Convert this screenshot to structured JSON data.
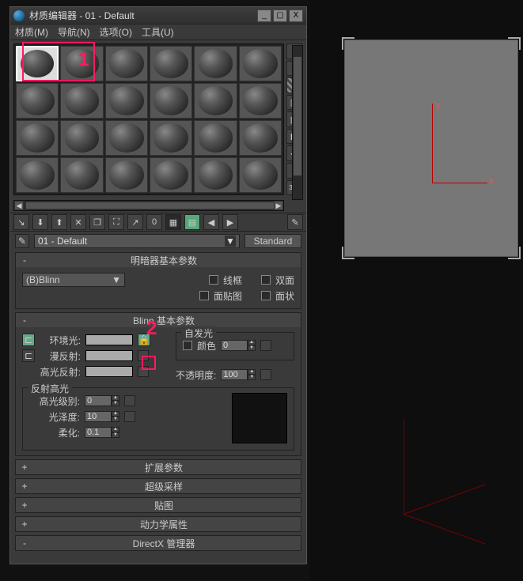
{
  "window": {
    "title": "材质编辑器 - 01 - Default",
    "buttons": {
      "min": "_",
      "max": "▢",
      "close": "X"
    }
  },
  "menubar": {
    "material": "材质(M)",
    "navigate": "导航(N)",
    "options": "选项(O)",
    "tools": "工具(U)"
  },
  "side_tools": {
    "sample_type": "○",
    "backlight": "◐",
    "background": "▦",
    "uv_tiling": "▥",
    "video_check": "▤",
    "preview": "▶",
    "options": "⋯",
    "select_by": "⌕",
    "magnify": "3×2"
  },
  "h_toolbar": {
    "get": "↘",
    "put_scene": "⬇",
    "assign": "⬆",
    "reset": "✕",
    "make_copy": "❐",
    "unique": "⛶",
    "put_lib": "↗",
    "mat_id": "0",
    "show_map": "▦",
    "show_end": "▤",
    "go_parent": "◀",
    "go_sibling": "▶",
    "pick": "✎"
  },
  "name_row": {
    "dropper": "✎",
    "material_name": "01 - Default",
    "type_button": "Standard"
  },
  "shader_params": {
    "title": "明暗器基本参数",
    "shader": "(B)Blinn",
    "wire": "线框",
    "two_sided": "双面",
    "face_map": "面贴图",
    "faceted": "面状"
  },
  "blinn_params": {
    "title": "Blinn 基本参数",
    "ambient": "环境光:",
    "diffuse": "漫反射:",
    "specular_color": "高光反射:",
    "self_illum_group": "自发光",
    "self_illum_color": "颜色",
    "self_illum_value": "0",
    "opacity": "不透明度:",
    "opacity_value": "100",
    "spec_group": "反射高光",
    "spec_level": "高光级别:",
    "spec_level_value": "0",
    "glossiness": "光泽度:",
    "glossiness_value": "10",
    "soften": "柔化:",
    "soften_value": "0.1"
  },
  "rollouts": {
    "extended": "扩展参数",
    "supersampling": "超级采样",
    "maps": "贴图",
    "dynamics": "动力学属性",
    "directx": "DirectX 管理器"
  },
  "annotations": {
    "one": "1",
    "two": "2"
  },
  "axes": {
    "x": "x",
    "y": "y"
  },
  "sample": {
    "selected_index": 0,
    "count": 24
  }
}
